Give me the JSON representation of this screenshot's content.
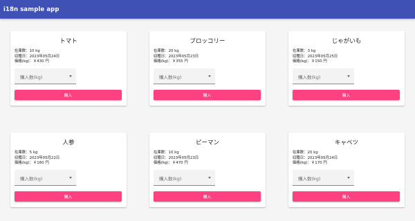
{
  "app": {
    "title": "i18n sample app",
    "bar_color": "#3f51b5",
    "accent_color": "#ff4081"
  },
  "products": [
    {
      "name": "トマト",
      "stock": "在庫数：10 kg",
      "date": "収穫日：2023年05月24日",
      "price": "価格(kg)：￥430 円",
      "select_placeholder": "購入数(kg)",
      "button_label": "購入"
    },
    {
      "name": "ブロッコリー",
      "stock": "在庫数：20 kg",
      "date": "収穫日：2023年05月23日",
      "price": "価格(kg)：￥355 円",
      "select_placeholder": "購入数(kg)",
      "button_label": "購入"
    },
    {
      "name": "じゃがいも",
      "stock": "在庫数：3 kg",
      "date": "収穫日：2023年05月25日",
      "price": "価格(kg)：￥150 円",
      "select_placeholder": "購入数(kg)",
      "button_label": "購入"
    },
    {
      "name": "人参",
      "stock": "在庫数：5 kg",
      "date": "収穫日：2023年05月22日",
      "price": "価格(kg)：￥160 円",
      "select_placeholder": "購入数(kg)",
      "button_label": "購入"
    },
    {
      "name": "ピーマン",
      "stock": "在庫数：10 kg",
      "date": "収穫日：2023年05月23日",
      "price": "価格(kg)：￥470 円",
      "select_placeholder": "購入数(kg)",
      "button_label": "購入"
    },
    {
      "name": "キャベツ",
      "stock": "在庫数：20 kg",
      "date": "収穫日：2023年05月24日",
      "price": "価格(kg)：￥170 円",
      "select_placeholder": "購入数(kg)",
      "button_label": "購入"
    }
  ]
}
